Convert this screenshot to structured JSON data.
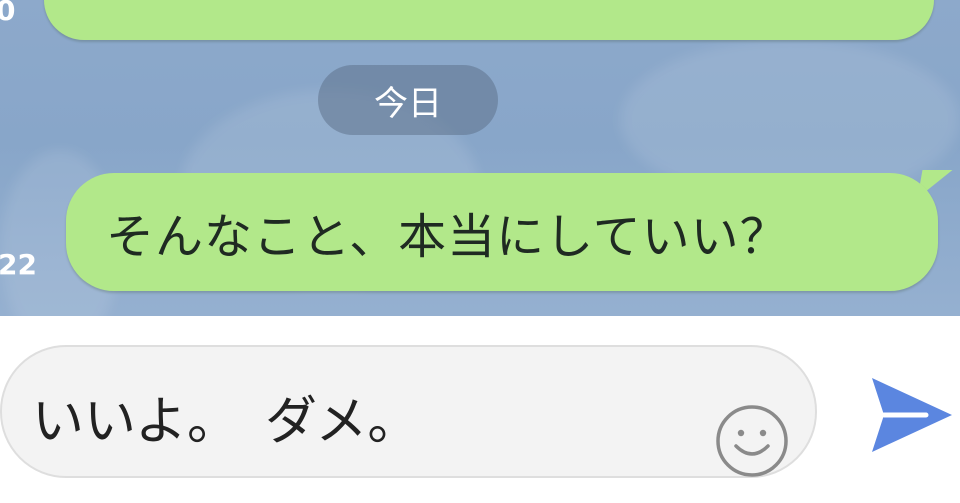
{
  "chat": {
    "date_separator": "今日",
    "prev_time": "0",
    "message_time": "22",
    "message_text": "そんなこと、本当にしていい？"
  },
  "composer": {
    "input_value": "いいよ。　ダメ。",
    "emoji_icon": "smiley-icon",
    "send_icon": "send-icon"
  },
  "colors": {
    "bubble": "#b2e88a",
    "send": "#5b86e0",
    "chat_bg": "#8da9cb"
  }
}
